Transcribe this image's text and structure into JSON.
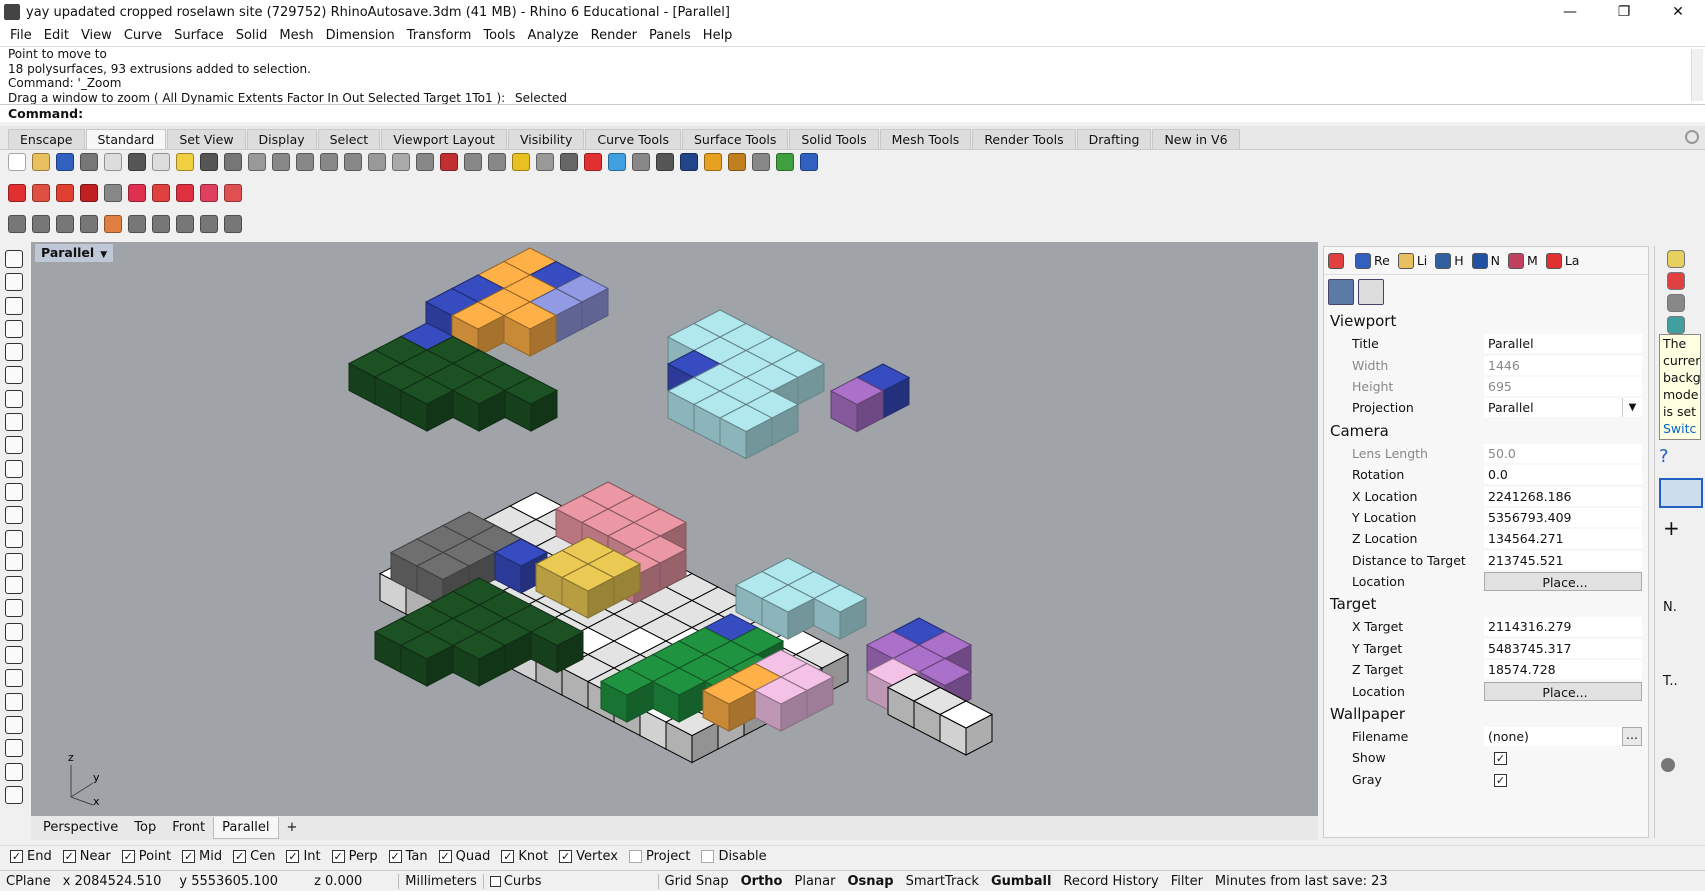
{
  "window": {
    "title": "yay upadated cropped roselawn site (729752) RhinoAutosave.3dm (41 MB) - Rhino 6 Educational - [Parallel]",
    "min": "—",
    "max": "❐",
    "close": "✕"
  },
  "menu": [
    "File",
    "Edit",
    "View",
    "Curve",
    "Surface",
    "Solid",
    "Mesh",
    "Dimension",
    "Transform",
    "Tools",
    "Analyze",
    "Render",
    "Panels",
    "Help"
  ],
  "command_history": [
    "Point to move to",
    "18 polysurfaces, 93 extrusions added to selection.",
    "Command: '_Zoom",
    "Drag a window to zoom ( All  Dynamic  Extents  Factor  In  Out  Selected  Target  1To1 ): _Selected"
  ],
  "command_prompt": "Command:",
  "toolbar_tabs": [
    "Enscape",
    "Standard",
    "Set View",
    "Display",
    "Select",
    "Viewport Layout",
    "Visibility",
    "Curve Tools",
    "Surface Tools",
    "Solid Tools",
    "Mesh Tools",
    "Render Tools",
    "Drafting",
    "New in V6"
  ],
  "active_tab": "Standard",
  "toolbar_icon_colors": {
    "row1": [
      "#fff",
      "#e8c060",
      "#3060c0",
      "#777",
      "#ddd",
      "#555",
      "#ddd",
      "#f0d040",
      "#555",
      "#777",
      "#999",
      "#888",
      "#888",
      "#888",
      "#888",
      "#999",
      "#aaa",
      "#888",
      "#c03030",
      "#888",
      "#888",
      "#e8c020",
      "#999",
      "#666",
      "#e03030",
      "#40a0e0",
      "#888",
      "#555",
      "#224488",
      "#e8a020",
      "#c08020",
      "#888",
      "#40a040",
      "#3060c0"
    ],
    "row2": [
      "#e03030",
      "#e05040",
      "#e04030",
      "#c02020",
      "#888",
      "#e03050",
      "#e04040",
      "#e03040",
      "#e04060",
      "#e05050"
    ],
    "row3": [
      "#777",
      "#777",
      "#777",
      "#777",
      "#e08040",
      "#777",
      "#777",
      "#777",
      "#777",
      "#777"
    ]
  },
  "viewport": {
    "label": "Parallel",
    "axis_z": "z",
    "axis_y": "y",
    "axis_x": "x"
  },
  "viewport_tabs": [
    "Perspective",
    "Top",
    "Front",
    "Parallel",
    "+"
  ],
  "active_viewport_tab": "Parallel",
  "osnaps": [
    {
      "label": "End",
      "on": true
    },
    {
      "label": "Near",
      "on": true
    },
    {
      "label": "Point",
      "on": true
    },
    {
      "label": "Mid",
      "on": true
    },
    {
      "label": "Cen",
      "on": true
    },
    {
      "label": "Int",
      "on": true
    },
    {
      "label": "Perp",
      "on": true
    },
    {
      "label": "Tan",
      "on": true
    },
    {
      "label": "Quad",
      "on": true
    },
    {
      "label": "Knot",
      "on": true
    },
    {
      "label": "Vertex",
      "on": true
    },
    {
      "label": "Project",
      "on": false
    },
    {
      "label": "Disable",
      "on": false
    }
  ],
  "status": {
    "cplane": "CPlane",
    "x": "x 2084524.510",
    "y": "y 5553605.100",
    "z": "z 0.000",
    "units": "Millimeters",
    "layer": "Curbs",
    "grid_snap": "Grid Snap",
    "ortho": "Ortho",
    "planar": "Planar",
    "osnap": "Osnap",
    "smarttrack": "SmartTrack",
    "gumball": "Gumball",
    "record_history": "Record History",
    "filter": "Filter",
    "minutes": "Minutes from last save: 23"
  },
  "panel_tabs": [
    {
      "label": "",
      "color": "#e04040"
    },
    {
      "label": "Re",
      "color": "#3060c0"
    },
    {
      "label": "Li",
      "color": "#e8c060"
    },
    {
      "label": "H",
      "color": "#3060a0"
    },
    {
      "label": "N",
      "color": "#2050a0"
    },
    {
      "label": "M",
      "color": "#c04060"
    },
    {
      "label": "La",
      "color": "#e03030"
    }
  ],
  "properties": {
    "viewport_section": "Viewport",
    "viewport_rows": [
      {
        "k": "Title",
        "v": "Parallel",
        "dis": false
      },
      {
        "k": "Width",
        "v": "1446",
        "dis": true
      },
      {
        "k": "Height",
        "v": "695",
        "dis": true
      },
      {
        "k": "Projection",
        "v": "Parallel",
        "dis": false
      }
    ],
    "camera_section": "Camera",
    "camera_rows": [
      {
        "k": "Lens Length",
        "v": "50.0",
        "dis": true
      },
      {
        "k": "Rotation",
        "v": "0.0",
        "dis": false
      },
      {
        "k": "X Location",
        "v": "2241268.186",
        "dis": false
      },
      {
        "k": "Y Location",
        "v": "5356793.409",
        "dis": false
      },
      {
        "k": "Z Location",
        "v": "134564.271",
        "dis": false
      },
      {
        "k": "Distance to Target",
        "v": "213745.521",
        "dis": false
      },
      {
        "k": "Location",
        "v": "Place...",
        "dis": false
      }
    ],
    "target_section": "Target",
    "target_rows": [
      {
        "k": "X Target",
        "v": "2114316.279",
        "dis": false
      },
      {
        "k": "Y Target",
        "v": "5483745.317",
        "dis": false
      },
      {
        "k": "Z Target",
        "v": "18574.728",
        "dis": false
      },
      {
        "k": "Location",
        "v": "Place...",
        "dis": false
      }
    ],
    "wallpaper_section": "Wallpaper",
    "wallpaper_rows": [
      {
        "k": "Filename",
        "v": "(none)"
      },
      {
        "k": "Show",
        "v": "✓"
      },
      {
        "k": "Gray",
        "v": "✓"
      }
    ]
  },
  "tooltip": {
    "lines": [
      "The",
      "curren",
      "backgr",
      "mode",
      "is set"
    ],
    "link": "Switc"
  },
  "right_strip_labels": [
    "N.",
    "T.."
  ],
  "block_colors": {
    "orange": "#f5a844",
    "navy": "#3448b8",
    "lavender": "#8b93d8",
    "dkgreen": "#1b4d22",
    "teal": "#a9dde3",
    "purple": "#a36cc0",
    "pink": "#e0909c",
    "gray": "#6a6a6a",
    "yellow": "#e0c050",
    "green": "#1e8c3e",
    "light": "#d8d8d8",
    "white": "#ffffff",
    "lpink": "#e8b8dc"
  }
}
